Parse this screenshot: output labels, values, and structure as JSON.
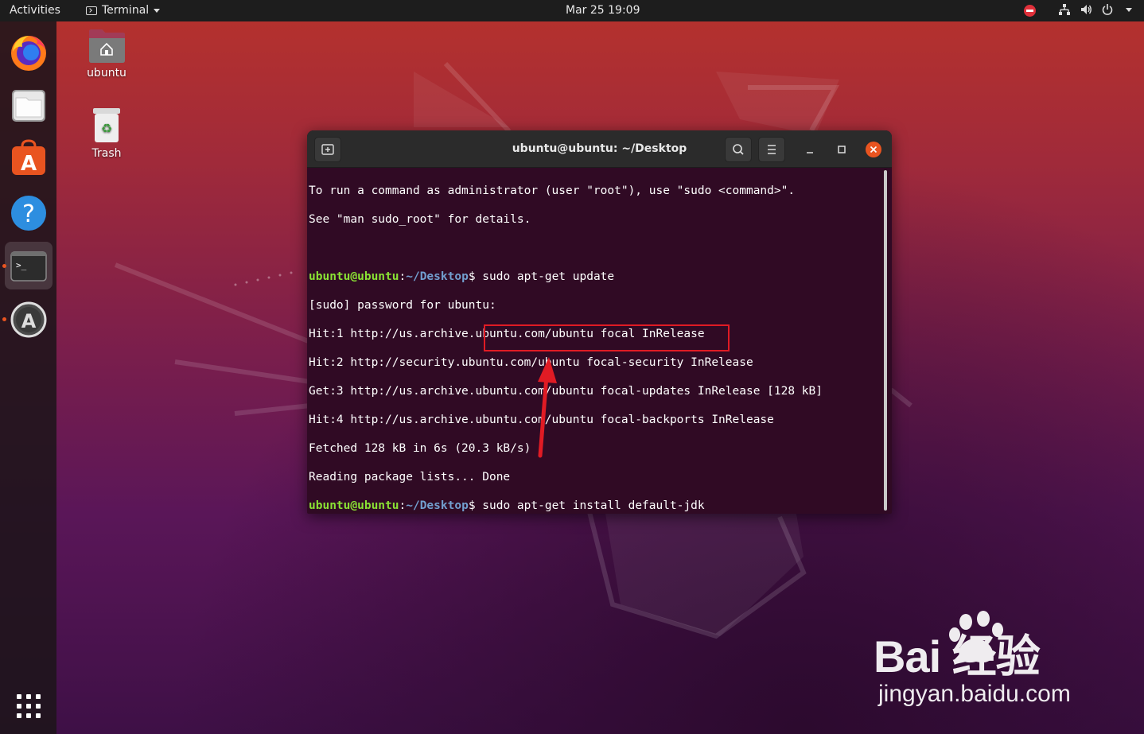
{
  "topbar": {
    "activities": "Activities",
    "app_name": "Terminal",
    "clock": "Mar 25  19:09"
  },
  "dock": {
    "items": [
      "firefox-icon",
      "files-icon",
      "software-icon",
      "help-icon",
      "terminal-icon",
      "software-updater-icon"
    ]
  },
  "desktop": {
    "icons": [
      {
        "label": "ubuntu"
      },
      {
        "label": "Trash"
      }
    ]
  },
  "terminal": {
    "title": "ubuntu@ubuntu: ~/Desktop",
    "prompt_user": "ubuntu@ubuntu",
    "prompt_sep": ":",
    "prompt_path": "~/Desktop",
    "prompt_end": "$",
    "lines": [
      "To run a command as administrator (user \"root\"), use \"sudo <command>\".",
      "See \"man sudo_root\" for details.",
      "",
      "[sudo] password for ubuntu:",
      "Hit:1 http://us.archive.ubuntu.com/ubuntu focal InRelease",
      "Hit:2 http://security.ubuntu.com/ubuntu focal-security InRelease",
      "Get:3 http://us.archive.ubuntu.com/ubuntu focal-updates InRelease [128 kB]",
      "Hit:4 http://us.archive.ubuntu.com/ubuntu focal-backports InRelease",
      "Fetched 128 kB in 6s (20.3 kB/s)",
      "Reading package lists... Done"
    ],
    "cmd1": " sudo apt-get update",
    "cmd2": " sudo apt-get install default-jdk"
  },
  "watermark": {
    "brand": "Bai  经验",
    "url": "jingyan.baidu.com"
  },
  "colors": {
    "accent": "#e95420",
    "prompt_user": "#8ae234",
    "prompt_path": "#729fcf",
    "terminal_bg": "#300a24",
    "annotation": "#e01b24"
  }
}
